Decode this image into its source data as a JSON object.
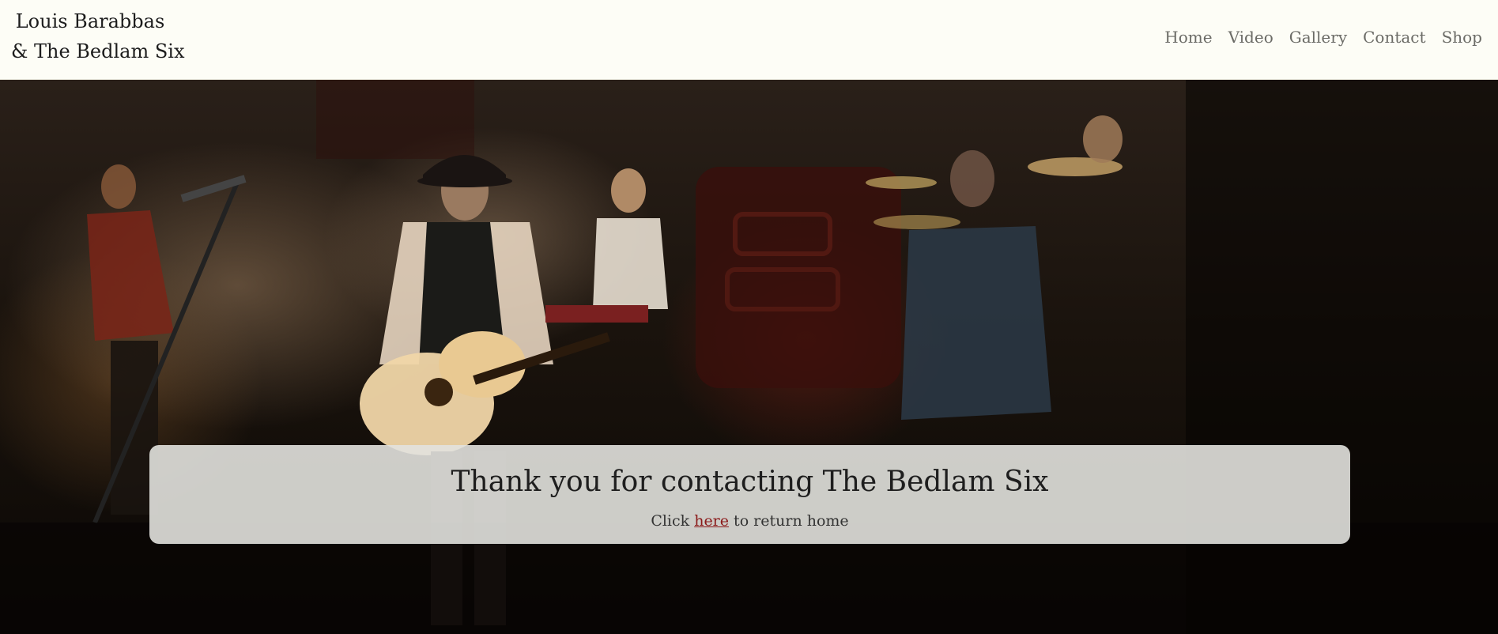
{
  "header": {
    "brand_line1": "Louis Barabbas",
    "brand_line2": "& The Bedlam Six",
    "nav": [
      {
        "label": "Home"
      },
      {
        "label": "Video"
      },
      {
        "label": "Gallery"
      },
      {
        "label": "Contact"
      },
      {
        "label": "Shop"
      }
    ]
  },
  "hero": {
    "background": "concert-stage-photo"
  },
  "notice": {
    "heading": "Thank you for contacting The Bedlam Six",
    "text_before": "Click ",
    "link_label": "here",
    "text_after": " to return home"
  },
  "colors": {
    "header_bg": "#fdfdf6",
    "nav_text": "#6b6b66",
    "link": "#8b1a1a",
    "card_bg": "#e2e2de"
  }
}
